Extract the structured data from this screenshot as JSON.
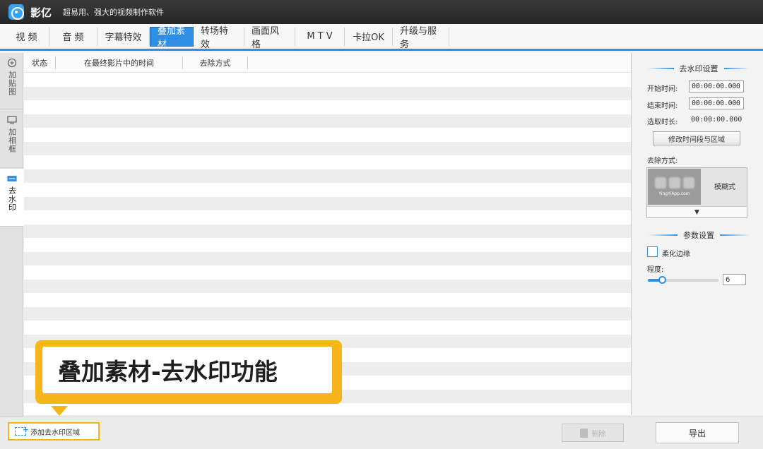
{
  "window": {
    "app_name": "影亿",
    "slogan": "超易用、强大的视频制作软件"
  },
  "tabs": [
    {
      "label": "视 频"
    },
    {
      "label": "音 频"
    },
    {
      "label": "字幕特效"
    },
    {
      "label": "叠加素材",
      "active": true
    },
    {
      "label": "转场特效"
    },
    {
      "label": "画面风格"
    },
    {
      "label": "M T V"
    },
    {
      "label": "卡拉OK"
    },
    {
      "label": "升级与服务"
    }
  ],
  "left_tabs": [
    {
      "label": "加贴图",
      "icon": "sticker-icon"
    },
    {
      "label": "加相框",
      "icon": "frame-icon"
    },
    {
      "label": "去水印",
      "icon": "watermark-icon",
      "active": true
    }
  ],
  "list": {
    "columns": [
      "状态",
      "在最终影片中的时间",
      "去除方式"
    ]
  },
  "callout": {
    "text": "叠加素材-去水印功能"
  },
  "bottom": {
    "add_label": "添加去水印区域",
    "delete_label": "删除",
    "export_label": "导出"
  },
  "panel": {
    "settings_title": "去水印设置",
    "start_label": "开始时间:",
    "start_value": "00:00:00.000",
    "end_label": "结束时间:",
    "end_value": "00:00:00.000",
    "duration_label": "选取时长:",
    "duration_value": "00:00:00.000",
    "modify_label": "修改时间段与区域",
    "method_label": "去除方式:",
    "method_thumb_caption": "YingYiApp.com",
    "method_value": "模糊式",
    "params_title": "参数设置",
    "soften_label": "柔化边缘",
    "soften_checked": false,
    "level_label": "程度:",
    "level_value": "6",
    "level_fraction": 0.2
  },
  "colors": {
    "accent": "#2f8fe6",
    "highlight": "#f6b51a"
  }
}
